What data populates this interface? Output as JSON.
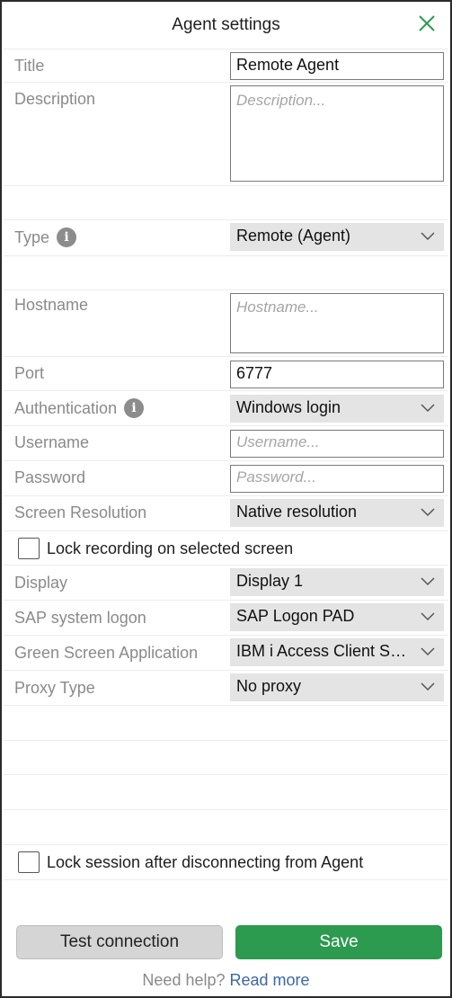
{
  "header": {
    "title": "Agent settings"
  },
  "fields": {
    "title_label": "Title",
    "title_value": "Remote Agent",
    "description_label": "Description",
    "description_placeholder": "Description...",
    "type_label": "Type",
    "type_value": "Remote (Agent)",
    "hostname_label": "Hostname",
    "hostname_placeholder": "Hostname...",
    "port_label": "Port",
    "port_value": "6777",
    "auth_label": "Authentication",
    "auth_value": "Windows login",
    "username_label": "Username",
    "username_placeholder": "Username...",
    "password_label": "Password",
    "password_placeholder": "Password...",
    "resolution_label": "Screen Resolution",
    "resolution_value": "Native resolution",
    "lock_recording_label": "Lock recording on selected screen",
    "display_label": "Display",
    "display_value": "Display 1",
    "sap_label": "SAP system logon",
    "sap_value": "SAP Logon PAD",
    "green_label": "Green Screen Application",
    "green_value": "IBM i Access Client Sol...",
    "proxy_label": "Proxy Type",
    "proxy_value": "No proxy",
    "lock_session_label": "Lock session after disconnecting from Agent"
  },
  "actions": {
    "test_label": "Test connection",
    "save_label": "Save"
  },
  "footer": {
    "help_text": "Need help?",
    "read_more": "Read more"
  },
  "colors": {
    "accent": "#2c9a4f",
    "link": "#3a67a8",
    "select_bg": "#e4e4e4"
  }
}
